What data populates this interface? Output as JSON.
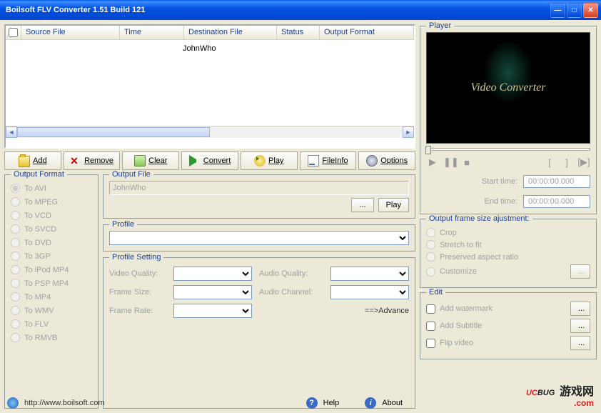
{
  "window": {
    "title": "Boilsoft FLV Converter 1.51 Build 121"
  },
  "table": {
    "columns": [
      "Source File",
      "Time",
      "Destination File",
      "Status",
      "Output Format"
    ],
    "center_text": "JohnWho"
  },
  "toolbar": {
    "add": "Add",
    "remove": "Remove",
    "clear": "Clear",
    "convert": "Convert",
    "play": "Play",
    "fileinfo": "FileInfo",
    "options": "Options"
  },
  "output_format": {
    "legend": "Output Format",
    "options": [
      "To AVI",
      "To MPEG",
      "To VCD",
      "To SVCD",
      "To DVD",
      "To 3GP",
      "To iPod MP4",
      "To PSP MP4",
      "To MP4",
      "To WMV",
      "To FLV",
      "To RMVB"
    ],
    "selected_index": 0
  },
  "output_file": {
    "legend": "Output File",
    "value": "JohnWho",
    "browse": "...",
    "play": "Play"
  },
  "profile": {
    "legend": "Profile"
  },
  "profile_setting": {
    "legend": "Profile Setting",
    "video_quality": "Video Quality:",
    "frame_size": "Frame Size:",
    "frame_rate": "Frame Rate:",
    "audio_quality": "Audio Quality:",
    "audio_channel": "Audio Channel:",
    "advance": "==>Advance"
  },
  "player": {
    "legend": "Player",
    "overlay": "Video Converter",
    "start_label": "Start  time:",
    "end_label": "End  time:",
    "start_value": "00:00:00.000",
    "end_value": "00:00:00.000"
  },
  "adjust": {
    "legend": "Output frame size ajustment:",
    "options": [
      "Crop",
      "Stretch to fit",
      "Preserved aspect ratio",
      "Customize"
    ],
    "browse": "..."
  },
  "edit": {
    "legend": "Edit",
    "watermark": "Add watermark",
    "subtitle": "Add Subtitle",
    "flip": "Flip video",
    "browse": "..."
  },
  "footer": {
    "url": "http://www.boilsoft.com",
    "help": "Help",
    "about": "About"
  },
  "watermark": {
    "uc": "UC",
    "bug": "BUG",
    "cn": "游戏网",
    "com": ".com"
  }
}
